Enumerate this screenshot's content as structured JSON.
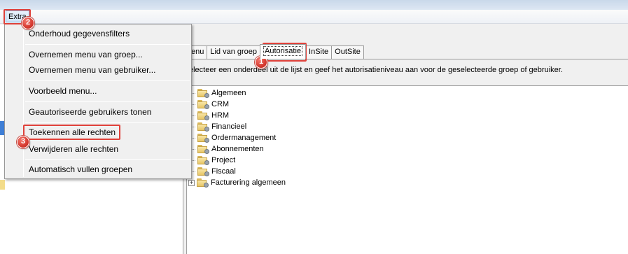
{
  "menubar": {
    "extra_label": "Extra"
  },
  "menu": {
    "items": [
      "Onderhoud gegevensfilters",
      "Overnemen menu van groep...",
      "Overnemen menu van gebruiker...",
      "Voorbeeld menu...",
      "Geautoriseerde gebruikers tonen",
      "Toekennen alle rechten",
      "Verwijderen alle rechten",
      "Automatisch vullen groepen"
    ]
  },
  "tabs": [
    "enu",
    "Lid van groep",
    "Autorisatie",
    "InSite",
    "OutSite"
  ],
  "active_tab": "Autorisatie",
  "instruction": "electeer een onderdeel uit de lijst en geef het autorisatieniveau aan voor de geselecteerde groep of gebruiker.",
  "tree": {
    "items": [
      "Algemeen",
      "CRM",
      "HRM",
      "Financieel",
      "Ordermanagement",
      "Abonnementen",
      "Project",
      "Fiscaal",
      "Facturering algemeen"
    ],
    "expander_symbol": "+"
  },
  "markers": [
    "1",
    "2",
    "3"
  ],
  "colors": {
    "highlight": "#e0413a",
    "marker": "#d63a30",
    "folder": "#e6c565"
  }
}
